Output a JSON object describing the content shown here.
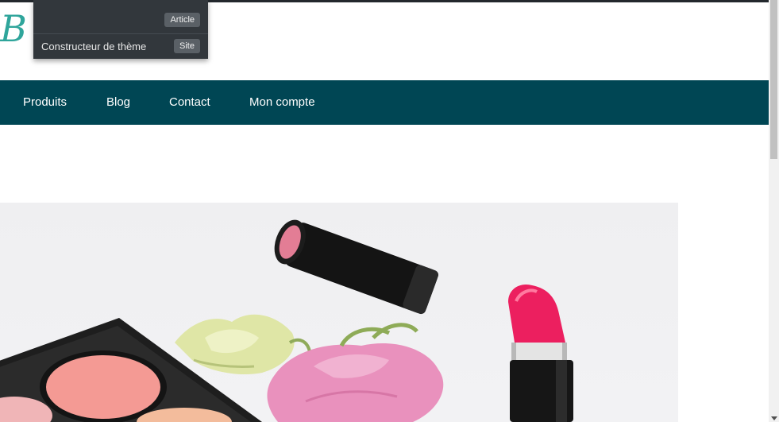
{
  "admin_menu": {
    "items": [
      {
        "label": "",
        "badge": "Article"
      },
      {
        "label": "Constructeur de thème",
        "badge": "Site"
      }
    ]
  },
  "nav": {
    "items": [
      "Produits",
      "Blog",
      "Contact",
      "Mon compte"
    ]
  },
  "colors": {
    "nav_background": "#004654",
    "logo_teal": "#2fa59b",
    "admin_dark": "#32373c"
  }
}
